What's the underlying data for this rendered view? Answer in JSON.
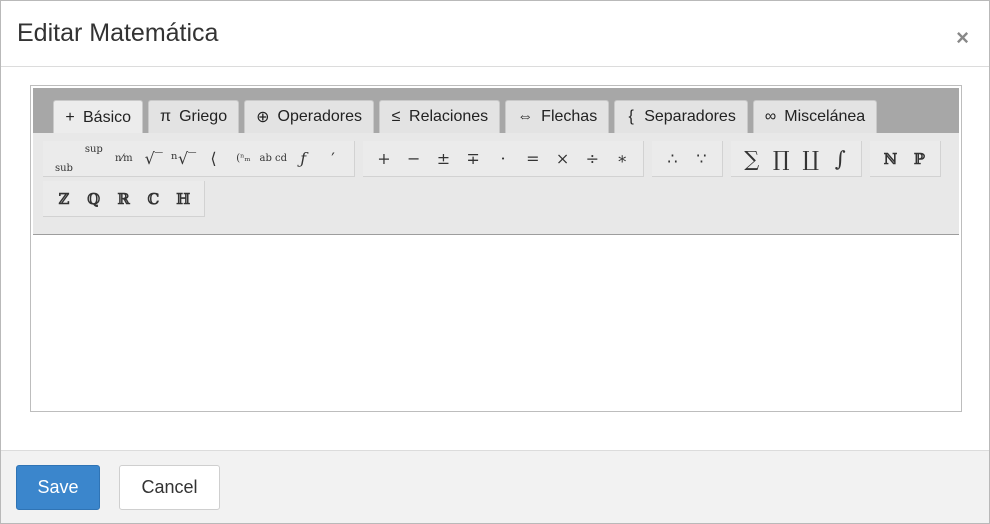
{
  "dialog": {
    "title": "Editar Matemática",
    "close_icon": "×"
  },
  "tabs": [
    {
      "icon": "+",
      "label": "Básico",
      "active": true
    },
    {
      "icon": "π",
      "label": "Griego"
    },
    {
      "icon": "⊕",
      "label": "Operadores"
    },
    {
      "icon": "≤",
      "label": "Relaciones"
    },
    {
      "icon": "⇔",
      "label": "Flechas"
    },
    {
      "icon": "{",
      "label": "Separadores"
    },
    {
      "icon": "∞",
      "label": "Miscelánea"
    }
  ],
  "symbols": {
    "row1_group1": [
      "sub",
      "sup",
      "n⁄m",
      "√‾",
      "ⁿ√‾",
      "⟨",
      "(ⁿₘ",
      "ab cd",
      "ƒ",
      "′"
    ],
    "row1_group2": [
      "+",
      "−",
      "±",
      "∓",
      "·",
      "=",
      "×",
      "÷",
      "∗"
    ],
    "row1_group3": [
      "∴",
      "∵"
    ],
    "row1_group4": [
      "∑",
      "∏",
      "∐",
      "∫"
    ],
    "row1_group5": [
      "ℕ",
      "ℙ"
    ],
    "row2_group1": [
      "ℤ",
      "ℚ",
      "ℝ",
      "ℂ",
      "ℍ"
    ]
  },
  "footer": {
    "save_label": "Save",
    "cancel_label": "Cancel"
  },
  "colors": {
    "save_button": "#3b86cc",
    "toolbar": "#a7a7a7",
    "panel": "#e8e8e8"
  }
}
